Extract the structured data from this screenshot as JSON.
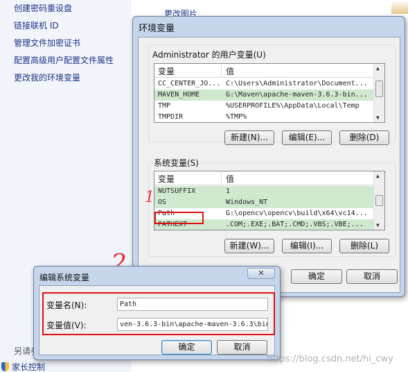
{
  "left_panel": {
    "links": [
      "创建密码重设盘",
      "链接联机 ID",
      "管理文件加密证书",
      "配置高级用户配置文件属性",
      "更改我的环境变量"
    ],
    "footer_label": "另请参",
    "footer_link": "家长控制"
  },
  "background": {
    "link": "更改图片"
  },
  "env_dialog": {
    "title": "环境变量",
    "user_vars": {
      "group_label": "Administrator 的用户变量(U)",
      "columns": [
        "变量",
        "值"
      ],
      "rows": [
        {
          "name": "CC_CENTER_JO...",
          "value": "C:\\Users\\Administrator\\Document..."
        },
        {
          "name": "MAVEN_HOME",
          "value": "G:\\Maven\\apache-maven-3.6.3-bin..."
        },
        {
          "name": "TMP",
          "value": "%USERPROFILE%\\AppData\\Local\\Temp"
        },
        {
          "name": "TMPDIR",
          "value": "%TMP%"
        }
      ],
      "buttons": [
        "新建(N)...",
        "编辑(E)...",
        "删除(D)"
      ]
    },
    "system_vars": {
      "group_label": "系统变量(S)",
      "columns": [
        "变量",
        "值"
      ],
      "rows": [
        {
          "name": "NUTSUFFIX",
          "value": "1"
        },
        {
          "name": "OS",
          "value": "Windows_NT"
        },
        {
          "name": "Path",
          "value": "G:\\opencv\\opencv\\build\\x64\\vc14..."
        },
        {
          "name": "PATHEXT",
          "value": ".COM;.EXE;.BAT;.CMD;.VBS;.VBE;..."
        }
      ],
      "buttons": [
        "新建(W)...",
        "编辑(I)...",
        "删除(L)"
      ]
    },
    "ok": "确定",
    "cancel": "取消"
  },
  "edit_dialog": {
    "title": "编辑系统变量",
    "close_glyph": "✕",
    "name_label": "变量名(N):",
    "name_value": "Path",
    "value_label": "变量值(V):",
    "value_value": "ven-3.6.3-bin\\apache-maven-3.6.3\\bin",
    "ok": "确定",
    "cancel": "取消"
  },
  "annotations": [
    "1",
    "2"
  ],
  "watermark": "https://blog.csdn.net/hi_cwy",
  "colors": {
    "highlight": "#e01010",
    "selected_row": "#cfe9cf",
    "dialog_frame": "#c5d6ec"
  }
}
